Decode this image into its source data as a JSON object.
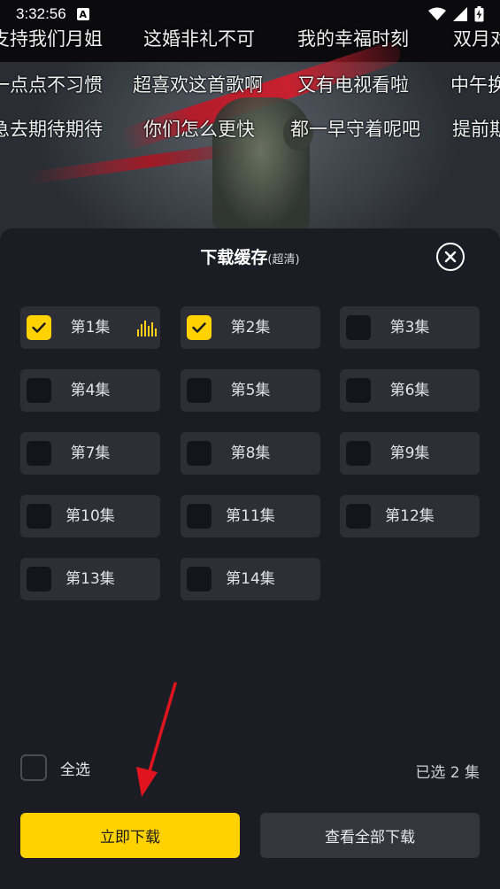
{
  "status_bar": {
    "time": "3:32:56",
    "notification_icon": "A"
  },
  "danmaku": {
    "row1": [
      "支持我们月姐",
      "这婚非礼不可",
      "我的幸福时刻",
      "双月对"
    ],
    "row2": [
      "一点点不习惯",
      "超喜欢这首歌啊",
      "又有电视看啦",
      "中午换"
    ],
    "row3": [
      "急去期待期待",
      "你们怎么更快",
      "都一早守着呢吧",
      "提前期"
    ]
  },
  "sheet": {
    "title": "下载缓存",
    "quality": "(超清)",
    "episodes": [
      {
        "label": "第1集",
        "checked": true,
        "playing": true
      },
      {
        "label": "第2集",
        "checked": true,
        "playing": false
      },
      {
        "label": "第3集",
        "checked": false,
        "playing": false
      },
      {
        "label": "第4集",
        "checked": false,
        "playing": false
      },
      {
        "label": "第5集",
        "checked": false,
        "playing": false
      },
      {
        "label": "第6集",
        "checked": false,
        "playing": false
      },
      {
        "label": "第7集",
        "checked": false,
        "playing": false
      },
      {
        "label": "第8集",
        "checked": false,
        "playing": false
      },
      {
        "label": "第9集",
        "checked": false,
        "playing": false
      },
      {
        "label": "第10集",
        "checked": false,
        "playing": false
      },
      {
        "label": "第11集",
        "checked": false,
        "playing": false
      },
      {
        "label": "第12集",
        "checked": false,
        "playing": false
      },
      {
        "label": "第13集",
        "checked": false,
        "playing": false
      },
      {
        "label": "第14集",
        "checked": false,
        "playing": false
      }
    ],
    "select_all_label": "全选",
    "selected_count_text": "已选 2 集",
    "download_button": "立即下载",
    "view_all_button": "查看全部下载"
  },
  "colors": {
    "accent": "#ffd200",
    "sheet_bg": "#1c1d24",
    "item_bg": "#2d2e36",
    "annotation_arrow": "#e0141e"
  }
}
